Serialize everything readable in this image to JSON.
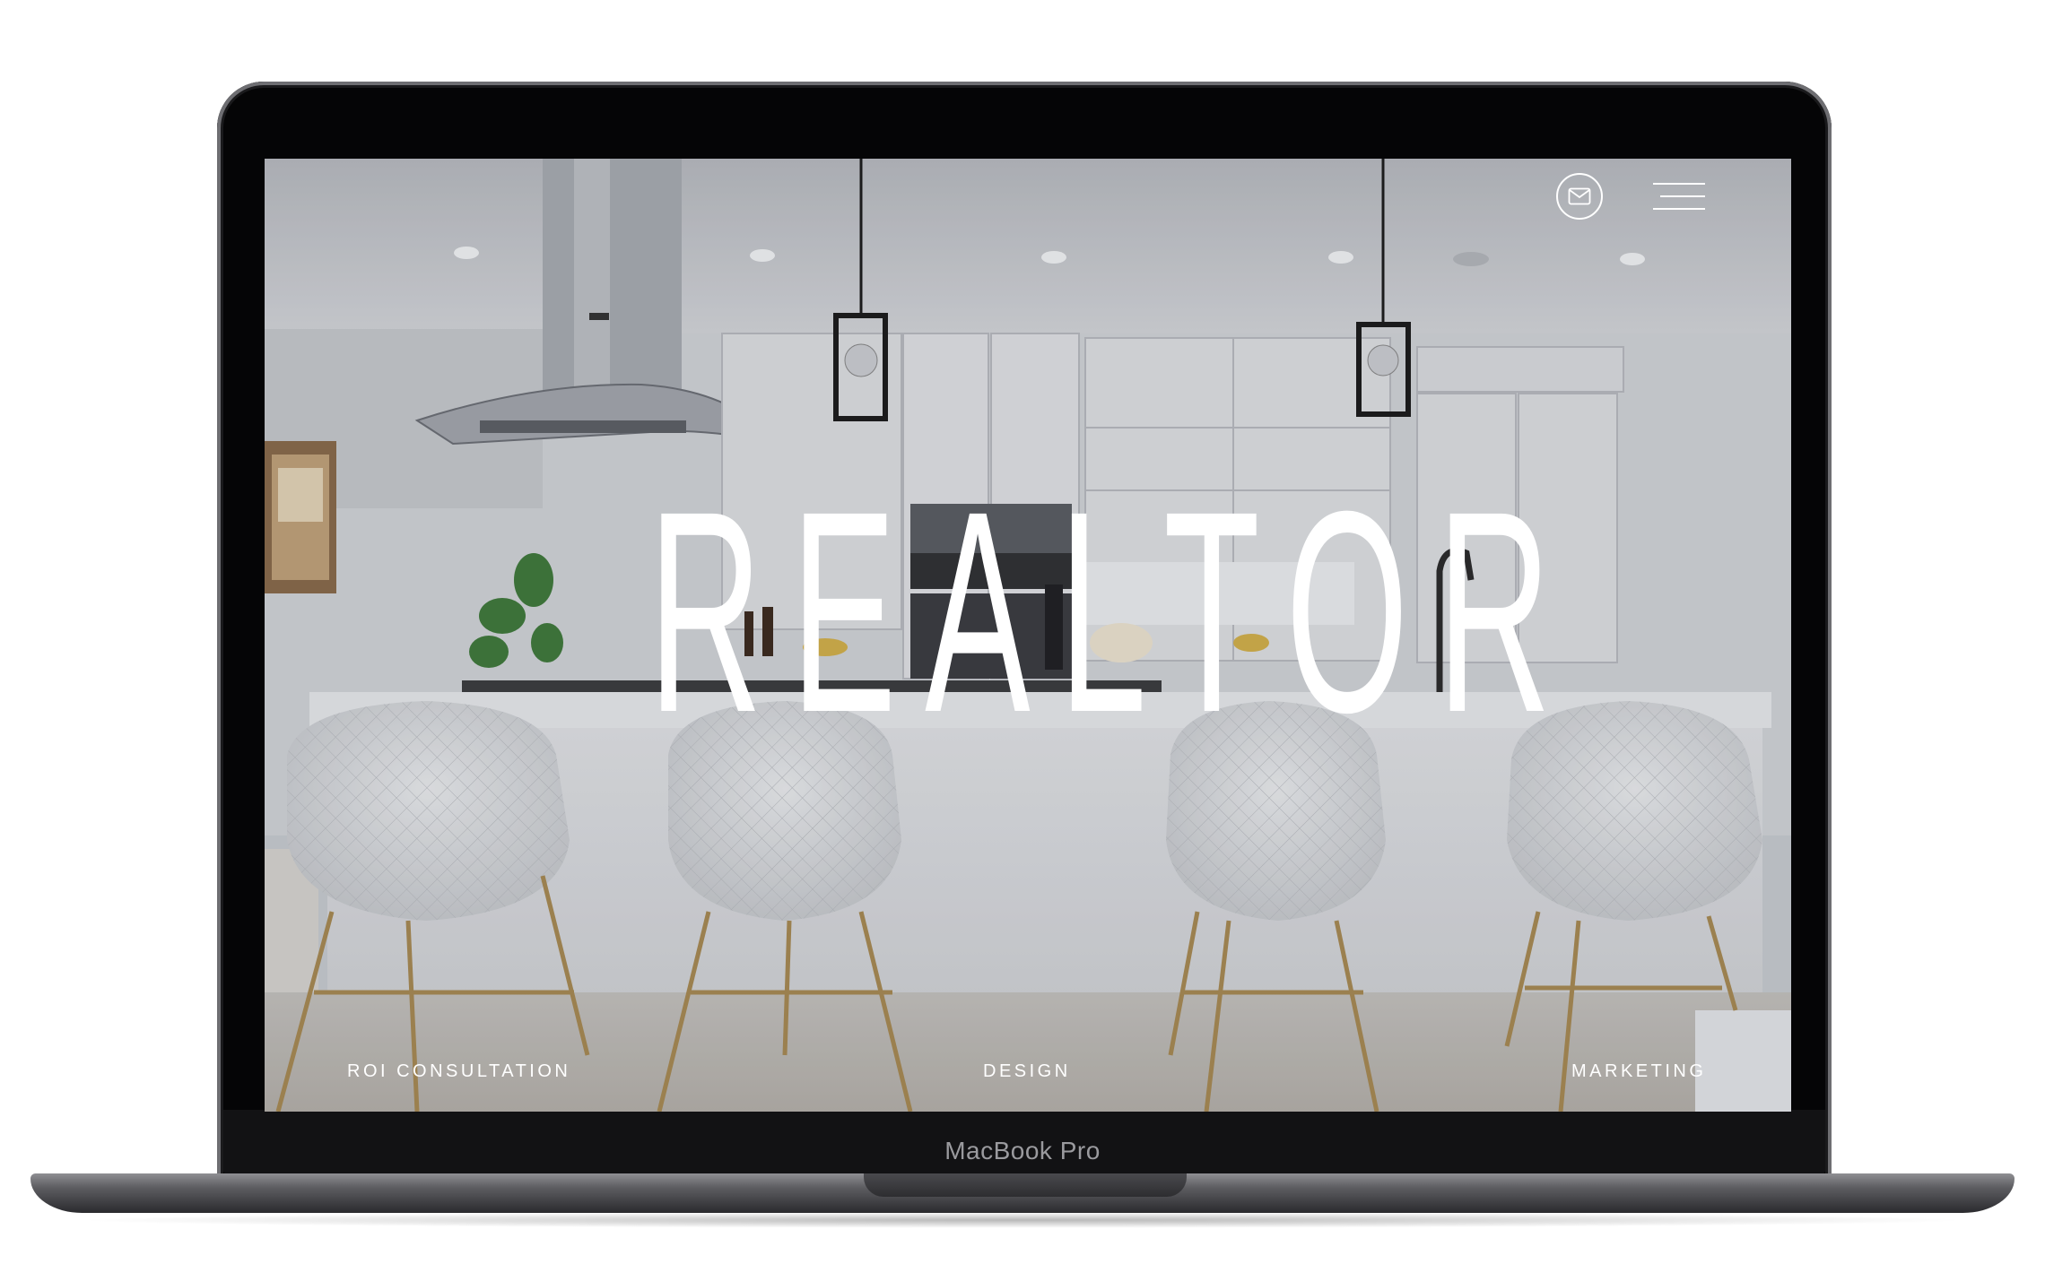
{
  "device": {
    "brand_label": "MacBook Pro"
  },
  "site": {
    "hero_title": "REALTOR",
    "header": {
      "mail_icon": "envelope-icon",
      "menu_icon": "hamburger-menu-icon"
    },
    "nav": [
      {
        "label": "ROI CONSULTATION"
      },
      {
        "label": "DESIGN"
      },
      {
        "label": "MARKETING"
      }
    ],
    "background": "kitchen-interior-photo"
  },
  "colors": {
    "title": "#ffffff",
    "bezel": "#050506",
    "aluminum": "#5e5e62"
  }
}
